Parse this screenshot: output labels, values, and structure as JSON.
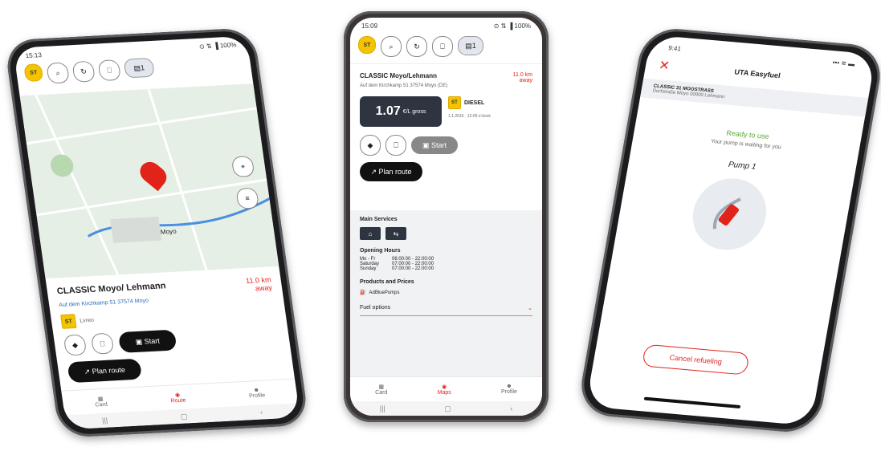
{
  "left": {
    "status_time": "15:13",
    "status_right": "⊙ ⇅ ▐ 100%",
    "badge": "ST",
    "count_chip": "1",
    "map_label_town": "Moyo",
    "station_name": "CLASSIC Moyo/ Lehmann",
    "station_address": "Auf dem Kirchkamp 51 37574 Moyo",
    "distance": "11.0 km away",
    "fuel_label": "Lvreo",
    "start_label": "Start",
    "plan_route_label": "Plan route",
    "nav": [
      "Card",
      "Route",
      "Profile"
    ]
  },
  "center": {
    "status_time": "15:09",
    "status_right": "⊙ ⇅ ▐ 100%",
    "badge": "ST",
    "count_chip": "1",
    "station_name": "CLASSIC Moyo/Lehmann",
    "station_address": "Auf dem Kirchkamp 51 37574 Moyo (DE)",
    "distance": "11.0 km away",
    "price": "1.07",
    "price_unit": "€/L gross",
    "fuel_type": "DIESEL",
    "price_date": "1.1.2016 · 12:00 o'clock",
    "start_label": "Start",
    "plan_route_label": "Plan route",
    "main_services_title": "Main Services",
    "opening_hours_title": "Opening Hours",
    "hours": [
      {
        "day": "Mo - Fr",
        "time": "06:00:00 - 22:00:00"
      },
      {
        "day": "Saturday",
        "time": "07:00:00 - 22:00:00"
      },
      {
        "day": "Sunday",
        "time": "07:00:00 - 22:00:00"
      }
    ],
    "products_title": "Products and Prices",
    "product_item": "AdBluePumps",
    "fuel_options_label": "Fuel options",
    "nav": [
      "Card",
      "Maps",
      "Profile"
    ]
  },
  "right": {
    "status_time": "9:41",
    "status_right": "▪▪▪ ≋ ▬",
    "title": "UTA Easyfuel",
    "station_line1": "CLASSIC 31 MOOSTRASS",
    "station_line2": "Dorfstraße Moyo 00000 Lehmann",
    "ready_text": "Ready to use",
    "waiting_text": "Your pump is waiting for you",
    "pump_label": "Pump 1",
    "cancel_label": "Cancel refueling"
  },
  "colors": {
    "accent_red": "#e2231a",
    "badge_yellow": "#f5c400",
    "ready_green": "#5aa832",
    "price_box": "#2e3440"
  }
}
